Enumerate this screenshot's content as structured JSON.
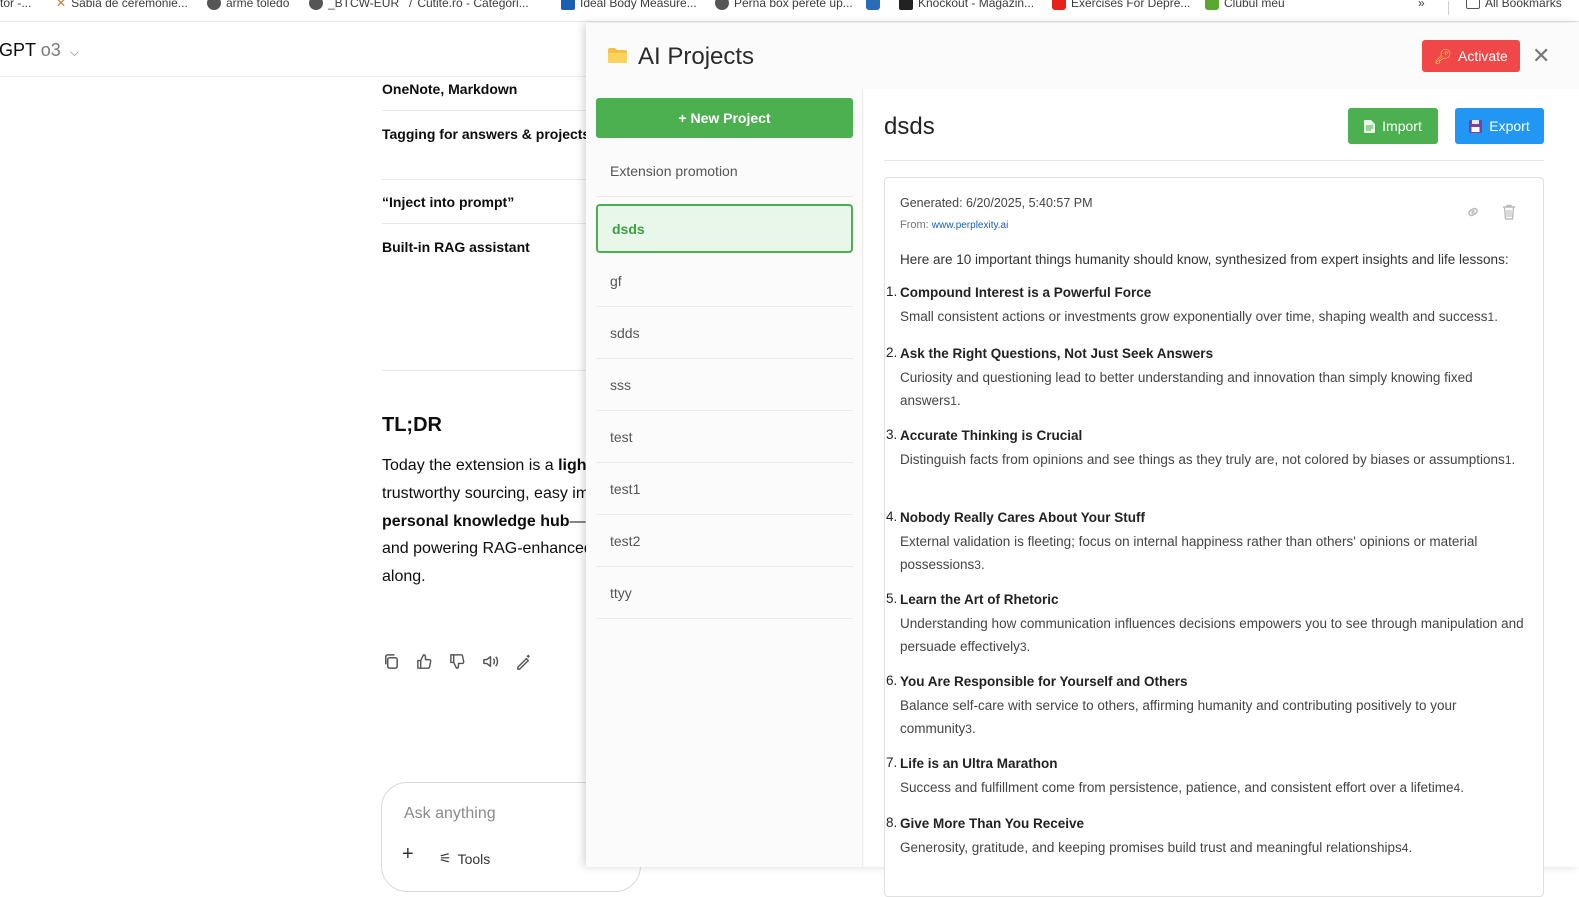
{
  "bookmarks": [
    {
      "label": "tor -...",
      "icon": "chrome-icon"
    },
    {
      "label": "Sabia de ceremonie...",
      "icon": "sword-icon"
    },
    {
      "label": "arme toledo",
      "icon": "globe-icon"
    },
    {
      "label": "_BTCW-EUR",
      "icon": "globe-icon"
    },
    {
      "label": "Cutite.ro - Categori...",
      "icon": "knife-icon"
    },
    {
      "label": "Ideal Body Measure...",
      "icon": "ps-icon"
    },
    {
      "label": "Perna box perete up...",
      "icon": "globe-icon"
    },
    {
      "label": "Knockout - Magazin...",
      "icon": "boxing-icon"
    },
    {
      "label": "Exercises For Depre...",
      "icon": "youtube-icon"
    },
    {
      "label": "Clubul meu",
      "icon": "star-icon"
    }
  ],
  "all_bookmarks": "All Bookmarks",
  "chat": {
    "model_name": "GPT",
    "model_prefix": "t",
    "model_version": "o3",
    "rows": [
      "OneNote, Markdown",
      "Tagging for answers & projects",
      "“Inject into prompt”",
      "Built-in RAG assistant"
    ],
    "tldr_heading": "TL;DR",
    "paragraph_lines": [
      {
        "pre": "Today the extension is a ",
        "bold": "light"
      },
      {
        "pre": "trustworthy sourcing, easy im",
        "bold": ""
      },
      {
        "pre": "",
        "bold": "personal knowledge hub",
        "post": "—sy"
      },
      {
        "pre": "and powering RAG-enhanced",
        "bold": ""
      },
      {
        "pre": "along.",
        "bold": ""
      }
    ],
    "ask_placeholder": "Ask anything",
    "tools_label": "Tools"
  },
  "panel": {
    "title": "AI Projects",
    "activate_label": "Activate",
    "new_project_label": "+  New Project",
    "projects": [
      "Extension promotion",
      "dsds",
      "gf",
      "sdds",
      "sss",
      "test",
      "test1",
      "test2",
      "ttyy"
    ],
    "active_project": "dsds",
    "project_title": "dsds",
    "import_label": "Import",
    "export_label": "Export",
    "card": {
      "generated_label": "Generated:",
      "generated_value": "6/20/2025, 5:40:57 PM",
      "from_label": "From:",
      "from_value": "www.perplexity.ai",
      "intro": "Here are 10 important things humanity should know, synthesized from expert insights and life lessons:",
      "items": [
        {
          "num": "1.",
          "title": "Compound Interest is a Powerful Force",
          "desc": "Small consistent actions or investments grow exponentially over time, shaping wealth and success",
          "ref": "1",
          "end": "."
        },
        {
          "num": "2.",
          "title": "Ask the Right Questions, Not Just Seek Answers",
          "desc": "Curiosity and questioning lead to better understanding and innovation than simply knowing fixed answers",
          "ref": "1",
          "end": "."
        },
        {
          "num": "3.",
          "title": "Accurate Thinking is Crucial",
          "desc": "Distinguish facts from opinions and see things as they truly are, not colored by biases or assumptions",
          "ref": "1",
          "end": "."
        },
        {
          "num": "4.",
          "title": "Nobody Really Cares About Your Stuff",
          "desc": "External validation is fleeting; focus on internal happiness rather than others' opinions or material possessions",
          "ref": "3",
          "end": "."
        },
        {
          "num": "5.",
          "title": "Learn the Art of Rhetoric",
          "desc": "Understanding how communication influences decisions empowers you to see through manipulation and persuade effectively",
          "ref": "3",
          "end": "."
        },
        {
          "num": "6.",
          "title": "You Are Responsible for Yourself and Others",
          "desc": "Balance self-care with service to others, affirming humanity and contributing positively to your community",
          "ref": "3",
          "end": "."
        },
        {
          "num": "7.",
          "title": "Life is an Ultra Marathon",
          "desc": "Success and fulfillment come from persistence, patience, and consistent effort over a lifetime",
          "ref": "4",
          "end": "."
        },
        {
          "num": "8.",
          "title": "Give More Than You Receive",
          "desc": "Generosity, gratitude, and keeping promises build trust and meaningful relationships",
          "ref": "4",
          "end": "."
        }
      ]
    }
  }
}
